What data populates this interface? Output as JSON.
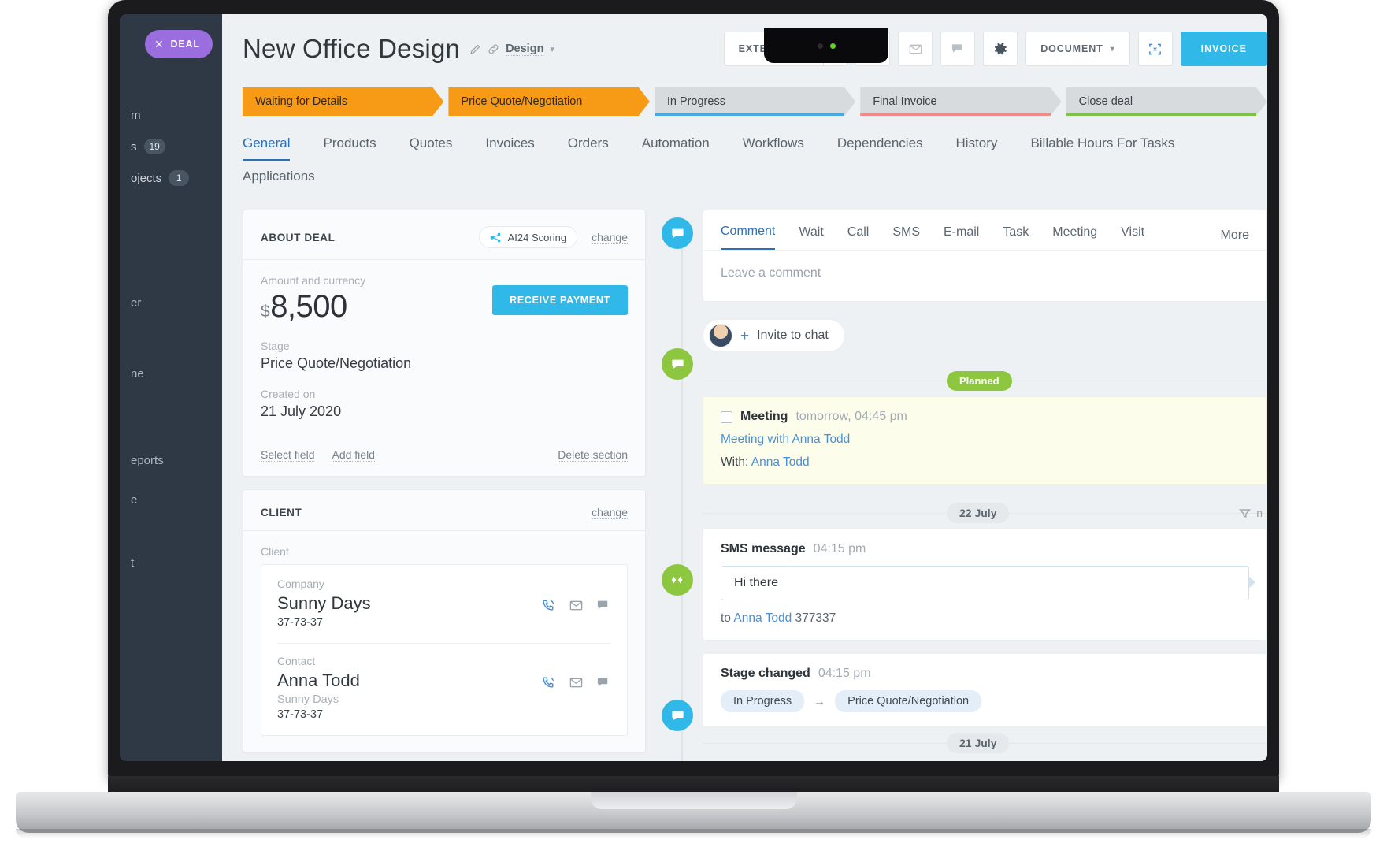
{
  "desktop": {
    "rail": {
      "deal_pill": "DEAL",
      "close_icon": "close-icon",
      "rows": [
        {
          "label": "m",
          "badge": ""
        },
        {
          "label": "s",
          "badge": "19"
        },
        {
          "label": "ojects",
          "badge": "1"
        },
        {
          "label": "er",
          "badge": ""
        },
        {
          "label": "ne",
          "badge": ""
        },
        {
          "label": "eports",
          "badge": ""
        },
        {
          "label": "e",
          "badge": ""
        },
        {
          "label": "t",
          "badge": ""
        }
      ],
      "printer_icon": "printer-icon"
    }
  },
  "header": {
    "title": "New Office  Design",
    "edit_icon": "pencil-icon",
    "link_icon": "link-icon",
    "category": "Design",
    "category_caret": "chevron-down-icon",
    "actions": {
      "extensions_label": "EXTENSIONS",
      "extensions_caret": "chevron-down-icon",
      "call_icon": "phone-icon",
      "email_icon": "envelope-icon",
      "chat_icon": "comment-icon",
      "settings_icon": "gear-icon",
      "document_label": "DOCUMENT",
      "document_caret": "chevron-down-icon",
      "fullscreen_icon": "expand-icon",
      "invoice_label": "INVOICE"
    }
  },
  "pipeline": {
    "stages": [
      {
        "label": "Waiting for Details",
        "state": "done",
        "underline": ""
      },
      {
        "label": "Price Quote/Negotiation",
        "state": "done",
        "underline": ""
      },
      {
        "label": "In Progress",
        "state": "pending",
        "underline": "#4aa8e0"
      },
      {
        "label": "Final Invoice",
        "state": "pending",
        "underline": "#ef8a86"
      },
      {
        "label": "Close deal",
        "state": "pending",
        "underline": "#7dc24b"
      }
    ]
  },
  "tabs": {
    "items": [
      {
        "label": "General",
        "active": true
      },
      {
        "label": "Products",
        "active": false
      },
      {
        "label": "Quotes",
        "active": false
      },
      {
        "label": "Invoices",
        "active": false
      },
      {
        "label": "Orders",
        "active": false
      },
      {
        "label": "Automation",
        "active": false
      },
      {
        "label": "Workflows",
        "active": false
      },
      {
        "label": "Dependencies",
        "active": false
      },
      {
        "label": "History",
        "active": false
      },
      {
        "label": "Billable Hours For Tasks",
        "active": false
      },
      {
        "label": "Applications",
        "active": false
      }
    ]
  },
  "about_deal": {
    "section_title": "ABOUT DEAL",
    "ai_badge": "AI24 Scoring",
    "ai_icon": "network-nodes-icon",
    "change_link": "change",
    "amount_label": "Amount and currency",
    "currency_symbol": "$",
    "amount_value": "8,500",
    "receive_payment_label": "RECEIVE PAYMENT",
    "stage_label": "Stage",
    "stage_value": "Price Quote/Negotiation",
    "created_label": "Created on",
    "created_value": "21 July 2020",
    "select_field_link": "Select field",
    "add_field_link": "Add field",
    "delete_section_link": "Delete section"
  },
  "client": {
    "section_title": "CLIENT",
    "change_link": "change",
    "field_label": "Client",
    "company_label": "Company",
    "company_name": "Sunny Days",
    "company_phone": "37-73-37",
    "contact_label": "Contact",
    "contact_name": "Anna Todd",
    "contact_company": "Sunny Days",
    "contact_phone": "37-73-37",
    "icons": {
      "call": "phone-icon",
      "email": "envelope-icon",
      "chat": "comment-icon"
    }
  },
  "activity": {
    "tabs": [
      {
        "label": "Comment",
        "active": true
      },
      {
        "label": "Wait",
        "active": false
      },
      {
        "label": "Call",
        "active": false
      },
      {
        "label": "SMS",
        "active": false
      },
      {
        "label": "E-mail",
        "active": false
      },
      {
        "label": "Task",
        "active": false
      },
      {
        "label": "Meeting",
        "active": false
      },
      {
        "label": "Visit",
        "active": false
      }
    ],
    "more_label": "More",
    "comment_placeholder": "Leave a comment",
    "comment_node_icon": "comment-icon",
    "invite": {
      "label": "Invite to chat",
      "node_icon": "chat-icon",
      "avatar": "user-avatar",
      "plus_icon": "plus-icon"
    },
    "planned_badge": "Planned",
    "meeting": {
      "node_icon": "meeting-icon",
      "title": "Meeting",
      "time": "tomorrow, 04:45 pm",
      "subject": "Meeting with Anna Todd",
      "with_label": "With:",
      "with_value": "Anna Todd"
    },
    "date_divider_1": "22 July",
    "filter_label": "n",
    "filter_icon": "filter-icon",
    "sms": {
      "node_icon": "comment-icon",
      "title": "SMS message",
      "time": "04:15 pm",
      "body": "Hi there",
      "to_prefix": "to",
      "to_name": "Anna Todd",
      "to_number": "377337"
    },
    "stage_changed": {
      "node_icon": "info-icon",
      "title": "Stage changed",
      "time": "04:15 pm",
      "from": "In Progress",
      "arrow": "→",
      "to": "Price Quote/Negotiation"
    },
    "date_divider_2": "21 July"
  },
  "colors": {
    "accent_blue": "#2fb8e8",
    "tab_blue": "#2e6fb7",
    "stage_orange": "#f79a16",
    "green": "#8dc63f",
    "purple": "#9b6ee0"
  }
}
